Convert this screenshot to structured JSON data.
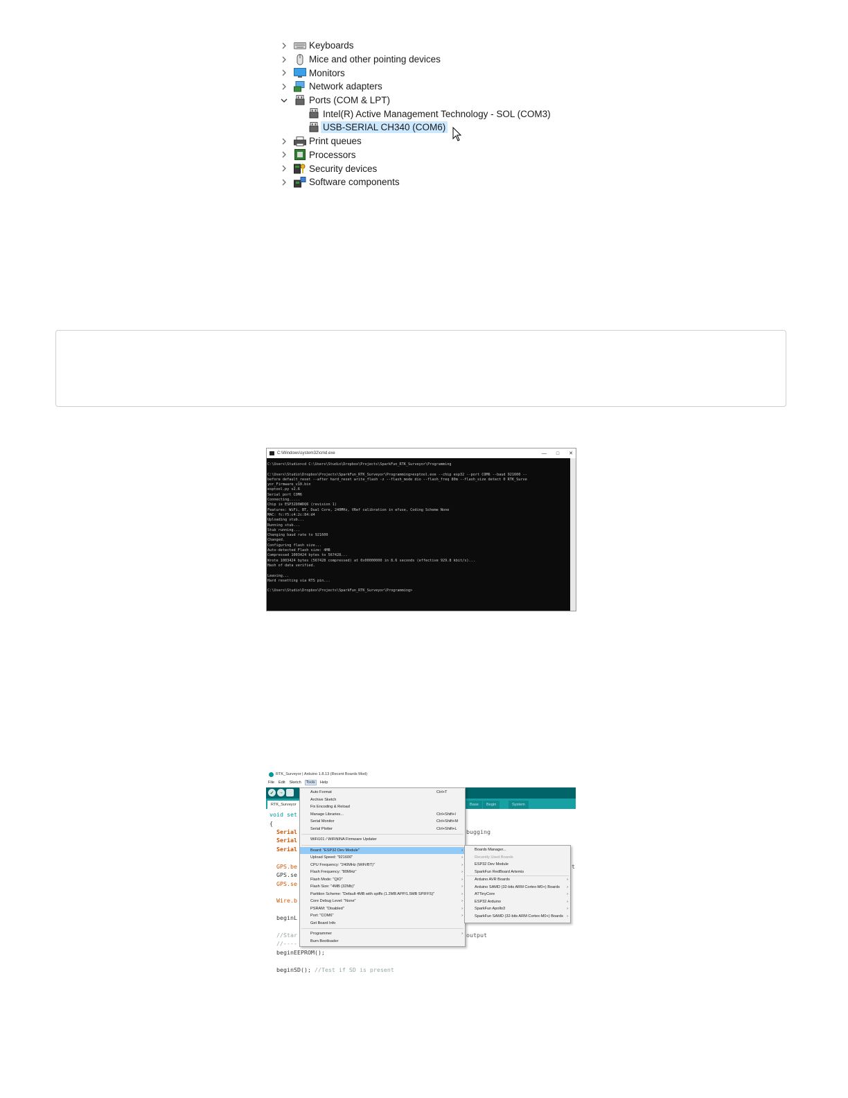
{
  "device_tree": {
    "items": [
      {
        "label": "Keyboards",
        "icon": "keyboard-icon",
        "expanded": false
      },
      {
        "label": "Mice and other pointing devices",
        "icon": "mouse-icon",
        "expanded": false
      },
      {
        "label": "Monitors",
        "icon": "monitor-icon",
        "expanded": false
      },
      {
        "label": "Network adapters",
        "icon": "network-adapter-icon",
        "expanded": false
      },
      {
        "label": "Ports (COM & LPT)",
        "icon": "port-icon",
        "expanded": true
      },
      {
        "label": "Intel(R) Active Management Technology - SOL (COM3)",
        "icon": "port-icon",
        "child": true
      },
      {
        "label": "USB-SERIAL CH340 (COM6)",
        "icon": "port-icon",
        "child": true,
        "selected": true
      },
      {
        "label": "Print queues",
        "icon": "printer-icon",
        "expanded": false
      },
      {
        "label": "Processors",
        "icon": "processor-icon",
        "expanded": false
      },
      {
        "label": "Security devices",
        "icon": "security-device-icon",
        "expanded": false
      },
      {
        "label": "Software components",
        "icon": "software-component-icon",
        "expanded": false
      }
    ]
  },
  "cmd_window": {
    "title": "C:\\Windows\\system32\\cmd.exe",
    "lines": [
      "C:\\Users\\Studio>cd C:\\Users\\Studio\\Dropbox\\Projects\\SparkFun_RTK_Surveyor\\Programming",
      "",
      "C:\\Users\\Studio\\Dropbox\\Projects\\SparkFun_RTK_Surveyor\\Programming>esptool.exe --chip esp32 --port COM6 --baud 921600 --",
      "before default_reset --after hard_reset write_flash -z --flash_mode dio --flash_freq 80m --flash_size detect 0 RTK_Surve",
      "yor_Firmware_v10.bin",
      "esptool.py v2.6",
      "Serial port COM6",
      "Connecting.....",
      "Chip is ESP32D0WDQ6 (revision 1)",
      "Features: WiFi, BT, Dual Core, 240MHz, VRef calibration in efuse, Coding Scheme None",
      "MAC: fc:f5:c4:2c:84:d4",
      "Uploading stub...",
      "Running stub...",
      "Stub running...",
      "Changing baud rate to 921600",
      "Changed.",
      "Configuring flash size...",
      "Auto-detected Flash size: 4MB",
      "Compressed 1003424 bytes to 567428...",
      "Wrote 1003424 bytes (567428 compressed) at 0x00000000 in 8.6 seconds (effective 929.8 kbit/s)...",
      "Hash of data verified.",
      "",
      "Leaving...",
      "Hard resetting via RTS pin...",
      "",
      "C:\\Users\\Studio\\Dropbox\\Projects\\SparkFun_RTK_Surveyor\\Programming>"
    ]
  },
  "arduino": {
    "title": "RTK_Surveyor | Arduino 1.8.13 (Recent Boards Mod)",
    "menubar": [
      "File",
      "Edit",
      "Sketch",
      "Tools",
      "Help"
    ],
    "tabs": [
      "RTK_Surveyor",
      "Base",
      "Begin",
      "System"
    ],
    "code": {
      "l1a": "void set",
      "l2": "{",
      "l3": "Serial",
      "l4": "Serial",
      "l5": "Serial",
      "l6": "GPS.be",
      "l7": "GPS.se",
      "l8": "GPS.se",
      "l9": "Wire.b",
      "l10": "beginL",
      "l11": "//Star",
      "l12": "//----",
      "l13": "beginEEPROM();",
      "l14a": "beginSD(); ",
      "l14b": "//Test if SD is present",
      "r1": "bugging",
      "r2": "t",
      "r3": "output"
    },
    "tools_menu": [
      {
        "label": "Auto Format",
        "shortcut": "Ctrl+T"
      },
      {
        "label": "Archive Sketch"
      },
      {
        "label": "Fix Encoding & Reload"
      },
      {
        "label": "Manage Libraries...",
        "shortcut": "Ctrl+Shift+I"
      },
      {
        "label": "Serial Monitor",
        "shortcut": "Ctrl+Shift+M"
      },
      {
        "label": "Serial Plotter",
        "shortcut": "Ctrl+Shift+L"
      },
      {
        "sep": true
      },
      {
        "label": "WiFi101 / WiFiNINA Firmware Updater"
      },
      {
        "sep": true
      },
      {
        "label": "Board: \"ESP32 Dev Module\"",
        "arrow": true,
        "highlight": true
      },
      {
        "label": "Upload Speed: \"921600\"",
        "arrow": true
      },
      {
        "label": "CPU Frequency: \"240MHz (WiFi/BT)\"",
        "arrow": true
      },
      {
        "label": "Flash Frequency: \"80MHz\"",
        "arrow": true
      },
      {
        "label": "Flash Mode: \"QIO\"",
        "arrow": true
      },
      {
        "label": "Flash Size: \"4MB (32Mb)\"",
        "arrow": true
      },
      {
        "label": "Partition Scheme: \"Default 4MB with spiffs (1.2MB APP/1.5MB SPIFFS)\"",
        "arrow": true
      },
      {
        "label": "Core Debug Level: \"None\"",
        "arrow": true
      },
      {
        "label": "PSRAM: \"Disabled\"",
        "arrow": true
      },
      {
        "label": "Port: \"COM6\"",
        "arrow": true
      },
      {
        "label": "Get Board Info"
      },
      {
        "sep": true
      },
      {
        "label": "Programmer",
        "arrow": true
      },
      {
        "label": "Burn Bootloader"
      }
    ],
    "board_submenu": [
      {
        "label": "Boards Manager..."
      },
      {
        "label": "Recently Used Boards",
        "disabled": true
      },
      {
        "label": "ESP32 Dev Module"
      },
      {
        "label": "SparkFun RedBoard Artemis"
      },
      {
        "sep": true
      },
      {
        "label": "Arduino AVR Boards",
        "arrow": true
      },
      {
        "label": "Arduino SAMD (32-bits ARM Cortex-M0+) Boards",
        "arrow": true
      },
      {
        "label": "ATTinyCore",
        "arrow": true
      },
      {
        "label": "ESP32 Arduino",
        "arrow": true
      },
      {
        "label": "SparkFun Apollo3",
        "arrow": true
      },
      {
        "label": "SparkFun SAMD (32-bits ARM Cortex-M0+) Boards",
        "arrow": true
      }
    ]
  }
}
